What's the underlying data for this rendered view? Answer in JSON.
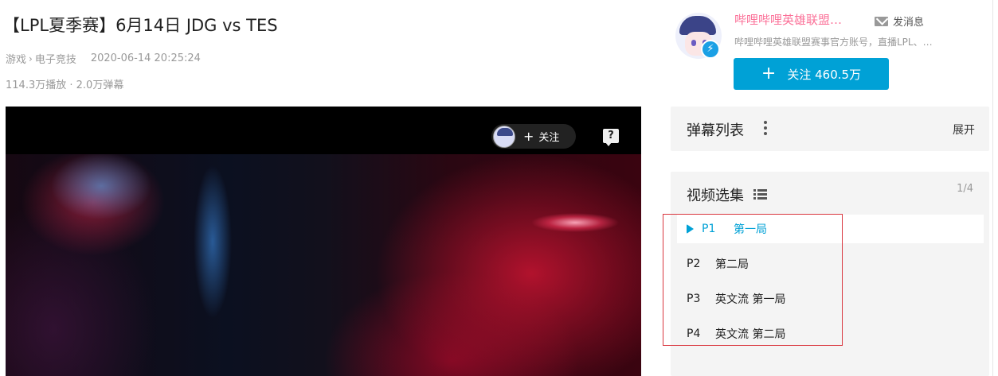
{
  "video": {
    "title": "【LPL夏季赛】6月14日 JDG vs TES",
    "category": "游戏",
    "subcategory": "电子竞技",
    "pubdate": "2020-06-14 20:25:24",
    "views": "114.3万播放",
    "separator": "·",
    "danmaku_count": "2.0万弹幕"
  },
  "player": {
    "follow_label": "关注",
    "help_icon": "?"
  },
  "uploader": {
    "name": "哔哩哔哩英雄联盟…",
    "message_label": "发消息",
    "description": "哔哩哔哩英雄联盟赛事官方账号，直播LPL、…",
    "follow_button": "关注 460.5万"
  },
  "danmaku_panel": {
    "title": "弹幕列表",
    "expand_label": "展开"
  },
  "multi_page": {
    "title": "视频选集",
    "page_count": "1/4",
    "episodes": [
      {
        "part": "P1",
        "title": "第一局",
        "active": true
      },
      {
        "part": "P2",
        "title": "第二局",
        "active": false
      },
      {
        "part": "P3",
        "title": "英文流 第一局",
        "active": false
      },
      {
        "part": "P4",
        "title": "英文流 第二局",
        "active": false
      }
    ]
  },
  "colors": {
    "accent": "#00a1d6",
    "uploader_name": "#fb7299",
    "highlight_box": "#d9363e"
  }
}
